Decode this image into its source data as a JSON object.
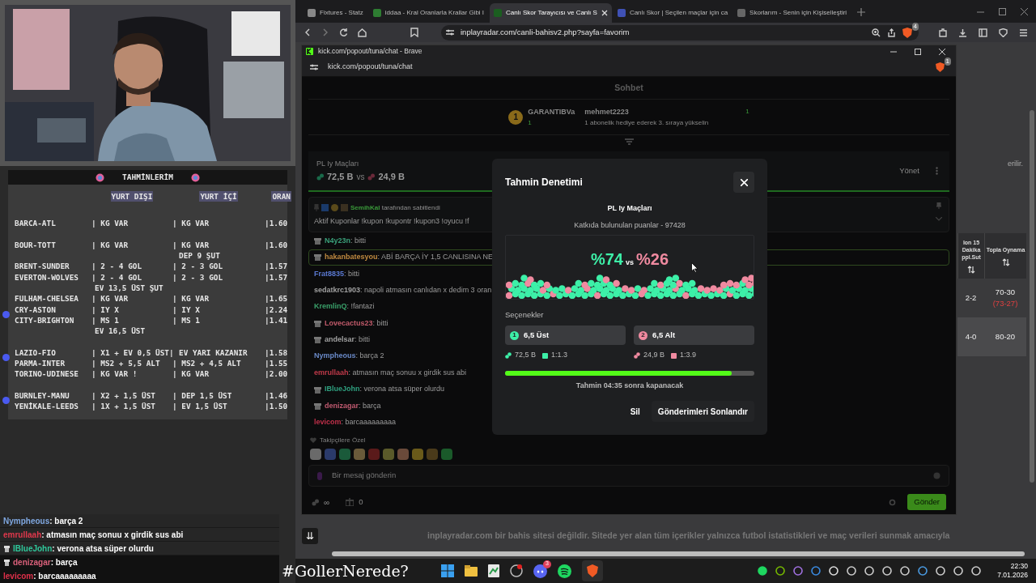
{
  "predictions_panel": {
    "title": "TAHMİNLERİM",
    "columns": [
      "YURT DIŞI",
      "YURT İÇİ",
      "ORAN"
    ],
    "groups": [
      [
        {
          "match": "BARCA-ATL",
          "away": "| KG VAR",
          "home": "| KG VAR",
          "odds": "|1.60",
          "marked": false
        }
      ],
      [
        {
          "match": "BOUR-TOTT",
          "away": "| KG VAR",
          "home": "| KG VAR",
          "odds": "|1.60",
          "marked": false
        },
        {
          "home": "DEP 9 ŞUT",
          "marked": false
        },
        {
          "match": "BRENT-SUNDER",
          "away": "| 2 - 4 GOL",
          "home": "| 2 - 3 GOL",
          "odds": "|1.57",
          "marked": false
        },
        {
          "match": "EVERTON-WOLVES",
          "away": "| 2 - 4 GOL",
          "home": "| 2 - 3 GOL",
          "odds": "|1.57",
          "marked": false
        },
        {
          "away": "EV 13,5 ÜST ŞUT",
          "marked": false
        },
        {
          "match": "FULHAM-CHELSEA",
          "away": "| KG VAR",
          "home": "| KG VAR",
          "odds": "|1.65",
          "marked": false
        },
        {
          "match": "CRY-ASTON",
          "away": "| IY X",
          "home": "| IY X",
          "odds": "|2.24",
          "marked": false
        },
        {
          "match": "CITY-BRIGHTON",
          "away": "| MS 1",
          "home": "| MS 1",
          "odds": "|1.41",
          "marked": true
        },
        {
          "away": "EV 16,5 ÜST",
          "marked": false
        }
      ],
      [
        {
          "match": "LAZIO-FIO",
          "away": "| X1 + EV 0,5 ÜST|",
          "home": "EV YARI KAZANIR",
          "odds": "|1.58",
          "marked": false
        },
        {
          "match": "PARMA-INTER",
          "away": "| MS2 + 5,5 ALT",
          "home": "| MS2 + 4,5 ALT",
          "odds": "|1.55",
          "marked": true
        },
        {
          "match": "TORINO-UDINESE",
          "away": "| KG VAR !",
          "home": "| KG VAR",
          "odds": "|2.00",
          "marked": false
        }
      ],
      [
        {
          "match": "BURNLEY-MANU",
          "away": "| X2 + 1,5 ÜST",
          "home": "| DEP 1,5 ÜST",
          "odds": "|1.46",
          "marked": false
        },
        {
          "match": "YENİKALE-LEEDS",
          "away": "| 1X + 1,5 ÜST",
          "home": "| EV 1,5 ÜST",
          "odds": "|1.50",
          "marked": true
        }
      ]
    ]
  },
  "stream_chat": [
    {
      "user": "Nympheous",
      "color": "#7fa7e0",
      "text": ": barça 2",
      "badge": false
    },
    {
      "user": "emrullaah",
      "color": "#e0384c",
      "text": ": atmasın maç sonuu x girdik sus abi",
      "badge": false
    },
    {
      "user": "IBlueJohn",
      "color": "#2fc79a",
      "text": ": verona atsa süper olurdu",
      "badge": true
    },
    {
      "user": "denizagar",
      "color": "#d9607a",
      "text": ": barça",
      "badge": true
    },
    {
      "user": "levicom",
      "color": "#e0304a",
      "text": ": barcaaaaaaaaa",
      "badge": false
    }
  ],
  "hashtag": "#GollerNerede?",
  "browser": {
    "tabs": [
      {
        "title": "Fixtures - Statz",
        "selected": false
      },
      {
        "title": "iddaa - Kral Oranlarla Krallar Gibi I",
        "selected": false
      },
      {
        "title": "Canlı Skor Tarayıcısı ve Canlı S",
        "selected": true
      },
      {
        "title": "Canlı Skor | Seçilen maçlar için ca",
        "selected": false
      },
      {
        "title": "Skorlarım - Senin için Kişiselleştiri",
        "selected": false
      }
    ],
    "url": "inplayradar.com/canli-bahisv2.php?sayfa=favorim",
    "shield_badge": "4"
  },
  "page": {
    "side_text": "erilir.",
    "table_header": [
      "lon 15 Dakika ppl.Sut",
      "Topla Oynama"
    ],
    "rows": [
      {
        "cells": [
          {
            "text": "2-2"
          },
          {
            "text": "70-30",
            "sub": "(73-27)"
          }
        ]
      },
      {
        "cells": [
          {
            "text": "4-0"
          },
          {
            "text": "80-20"
          }
        ]
      }
    ],
    "footer": "inplayradar.com bir bahis sitesi değildir. Sitede yer alan tüm içerikler yalnızca futbol istatistikleri ve maç verileri sunmak amacıyla",
    "scroll_button": "⇊"
  },
  "popup": {
    "title": "kick.com/popout/tuna/chat - Brave",
    "url": "kick.com/popout/tuna/chat",
    "shield_badge": "1",
    "chat": {
      "header": "Sohbet",
      "leaderboard": {
        "rank": "1",
        "user": "GARANTIBVa",
        "amount": "1",
        "next_user": "mehmet2223",
        "hint": "1 abonelik hediye ederek 3. sıraya yükselin",
        "right_amount": "1"
      },
      "prediction": {
        "title": "PL Iy Maçları",
        "left": "72,5 B",
        "vs": "vs",
        "right": "24,9 B",
        "action": "Yönet"
      },
      "pinned": {
        "user": "SemihKal",
        "by": "tarafından sabitlendi",
        "text": "Aktif Kuponlar !kupon !kupontr !kupon3 !oyucu !f"
      },
      "messages": [
        {
          "user": "N4y23n",
          "color": "#3aa07a",
          "text": ": bitti",
          "badge": true,
          "highlight": false
        },
        {
          "user": "hakanbatesyou",
          "color": "#c08a40",
          "text": ": ABİ BARÇA İY 1,5 CANLISINA NE",
          "badge": true,
          "highlight": true
        },
        {
          "user": "Frat8835",
          "color": "#5a78d0",
          "text": ": bitti",
          "badge": false,
          "highlight": false
        },
        {
          "user": "sedatkrc1903",
          "color": "#a0a0a0",
          "text": ": napoli atmasın canlıdan x dedim 3 oran",
          "badge": false,
          "highlight": false
        },
        {
          "user": "KremlinQ",
          "color": "#3aa06a",
          "text": ": !fantazi",
          "badge": false,
          "highlight": false
        },
        {
          "user": "Lovecactus23",
          "color": "#c05a6a",
          "text": ": bitti",
          "badge": true,
          "highlight": false
        },
        {
          "user": "andelsar",
          "color": "#a0a0a0",
          "text": ": bitti",
          "badge": true,
          "highlight": false
        },
        {
          "user": "Nympheous",
          "color": "#6a8ac8",
          "text": ": barça 2",
          "badge": false,
          "highlight": false
        },
        {
          "user": "emrullaah",
          "color": "#c03a4a",
          "text": ": atmasın maç sonuu x girdik sus abi",
          "badge": false,
          "highlight": false
        },
        {
          "user": "IBlueJohn",
          "color": "#2fa07f",
          "text": ": verona atsa süper olurdu",
          "badge": true,
          "highlight": false
        },
        {
          "user": "denizagar",
          "color": "#c05a70",
          "text": ": barça",
          "badge": true,
          "highlight": false
        },
        {
          "user": "levicom",
          "color": "#c0304a",
          "text": ": barcaaaaaaaaa",
          "badge": false,
          "highlight": false
        }
      ],
      "emotes_label": "Takipçilere Özel",
      "placeholder": "Bir mesaj gönderin",
      "points": "∞",
      "gifts": "0",
      "send": "Gönder"
    },
    "modal": {
      "title": "Tahmin Denetimi",
      "subtitle": "PL Iy Maçları",
      "points": "Katkıda bulunulan puanlar - 97428",
      "left_share": "%74",
      "vs": "vs",
      "right_share": "%26",
      "options_label": "Seçenekler",
      "options": [
        {
          "number": "1",
          "label": "6,5 Üst",
          "amount": "72,5 B",
          "ratio": "1:1.3",
          "color": "#3df0a8"
        },
        {
          "number": "2",
          "label": "6,5 Alt",
          "amount": "24,9 B",
          "ratio": "1:3.9",
          "color": "#f08aa0"
        }
      ],
      "level": 0.91,
      "timer": "Tahmin 04:35 sonra kapanacak",
      "buttons": [
        "Sil",
        "Gönderimleri Sonlandır"
      ]
    }
  },
  "taskbar": {
    "discord_badge": "3",
    "time": "22:30",
    "date": "7.01.2026"
  }
}
